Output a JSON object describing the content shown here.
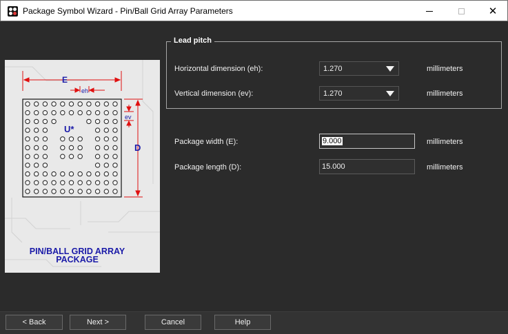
{
  "window": {
    "title": "Package Symbol Wizard - Pin/Ball Grid Array Parameters",
    "app_icon": "wizard-app-icon",
    "controls": [
      "minimize-icon",
      "maximize-icon",
      "close-icon"
    ]
  },
  "preview": {
    "dim_E": "E",
    "dim_eh": "eh",
    "dim_ev": "ev",
    "dim_D": "D",
    "designator": "U*",
    "caption_line1": "PIN/BALL GRID ARRAY",
    "caption_line2": "PACKAGE"
  },
  "lead_pitch": {
    "title": "Lead pitch",
    "horizontal": {
      "label": "Horizontal dimension (eh):",
      "value": "1.270",
      "unit": "millimeters"
    },
    "vertical": {
      "label": "Vertical dimension (ev):",
      "value": "1.270",
      "unit": "millimeters"
    }
  },
  "package": {
    "width": {
      "label": "Package width (E):",
      "value": "9.000",
      "unit": "millimeters"
    },
    "length": {
      "label": "Package length (D):",
      "value": "15.000",
      "unit": "millimeters"
    }
  },
  "buttons": {
    "back": "< Back",
    "next": "Next >",
    "cancel": "Cancel",
    "help": "Help"
  },
  "colors": {
    "background": "#2b2b2b",
    "dimension_red": "#e01010",
    "label_blue": "#1a1aa8"
  }
}
